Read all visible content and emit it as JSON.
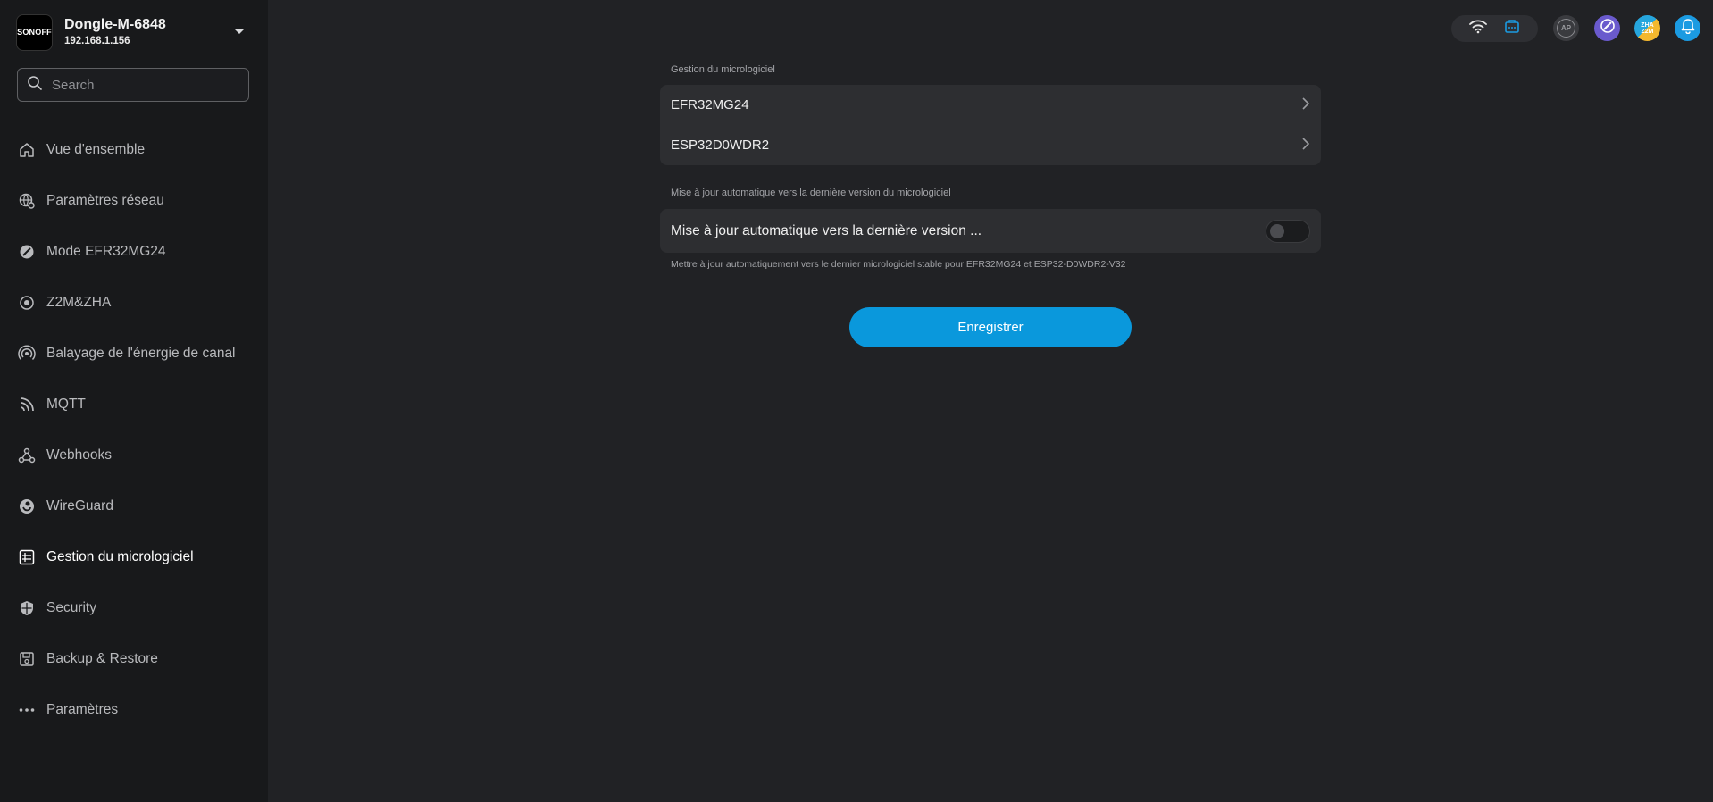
{
  "device": {
    "logo_text": "SONOFF",
    "name": "Dongle-M-6848",
    "ip": "192.168.1.156"
  },
  "search": {
    "placeholder": "Search"
  },
  "nav": {
    "items": [
      {
        "label": "Vue d'ensemble",
        "icon": "home-icon"
      },
      {
        "label": "Paramètres réseau",
        "icon": "network-globe-icon"
      },
      {
        "label": "Mode EFR32MG24",
        "icon": "mode-icon"
      },
      {
        "label": "Z2M&ZHA",
        "icon": "z2m-zha-icon"
      },
      {
        "label": "Balayage de l'énergie de canal",
        "icon": "signal-scan-icon"
      },
      {
        "label": "MQTT",
        "icon": "mqtt-icon"
      },
      {
        "label": "Webhooks",
        "icon": "webhooks-icon"
      },
      {
        "label": "WireGuard",
        "icon": "wireguard-icon"
      },
      {
        "label": "Gestion du micrologiciel",
        "icon": "firmware-icon",
        "active": true
      },
      {
        "label": "Security",
        "icon": "shield-icon"
      },
      {
        "label": "Backup & Restore",
        "icon": "backup-icon"
      },
      {
        "label": "Paramètres",
        "icon": "more-dots-icon"
      }
    ]
  },
  "topbar": {
    "ap_label": "AP",
    "z2m_label_top": "ZHA",
    "z2m_label_bottom": "Z2M"
  },
  "firmware": {
    "section_label": "Gestion du micrologiciel",
    "items": [
      {
        "label": "EFR32MG24"
      },
      {
        "label": "ESP32D0WDR2"
      }
    ]
  },
  "auto_update": {
    "section_label": "Mise à jour automatique vers la dernière version du micrologiciel",
    "row_label": "Mise à jour automatique vers la dernière version ...",
    "enabled": false,
    "helper": "Mettre à jour automatiquement vers le dernier micrologiciel stable pour EFR32MG24 et ESP32-D0WDR2-V32"
  },
  "save_button": {
    "label": "Enregistrer"
  },
  "colors": {
    "accent": "#0a98dc",
    "sidebar_bg": "#18191b",
    "main_bg": "#212225",
    "card_bg": "#2d2e31"
  }
}
